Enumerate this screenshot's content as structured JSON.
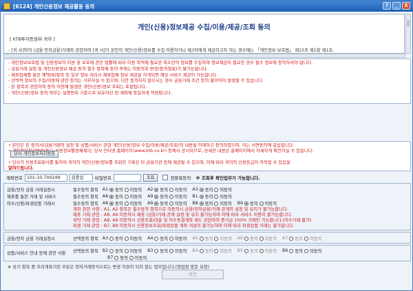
{
  "window": {
    "title": "[6124] 개인신용정보 제공활용 동의",
    "controls": [
      "?",
      "_",
      "X"
    ]
  },
  "document": {
    "title": "개인(신용)정보제공 수집/이용/제공/조회 동의",
    "recipient": "[ KTB투자증권㈜ 귀하 ]",
    "body": "- [귀 사]와의 (금융·전자금융)거래와 관련하여 [귀 사]가 본인의 개인(신용)정보를 수집 이용하거나 제3자에게 제공하고자 하는 경우에는 「개인정보 보호법」 제15조 제1항 제1호,"
  },
  "notice_top": [
    "- 개인정보보호법 및 신용정보의 이용 및 보호에 관한 법률에 따라 이용 목적에 필요한 최소한의 정보를 수집하며 정보제공이 필요한 경우 필수 정보에 동의하셔야 합니다.",
    "- 금융거래 설정 및 개인신용정보 제공 동의 필수 항목에 동의 후에는 미동의로 변경(동의철회)가 불가능합니다.",
    "- 제휴업체를 통한 혜택(B)항목 등 일부 정보 처리시 제휴업체 정보 제공을 하게되면 해당 서비스 제공이 가능합니다.",
    "- 선택적 정보의 수집/이용에 관한 동의는 거부하실 수 있으며, 다만 동의하지 않으시는 경우 금융거래 조건 등의 불이익이 발생할 수 있습니다.",
    "- 본 항목과 관련하여 동의 이전에 발생한 개인(신용)정보 조회는 포함됩니다.",
    "- 개인(신용)정보 동의 여부는 실명번호 기준으로 보유하신 전 계좌에 동일하게 적용됩니다."
  ],
  "notice_bottom": [
    "• 본인은 본 동의서(금융거래의 설정 및 상품/서비스 관련 개인(신용)정보 수집/이용/제공/조회)의 내용을 이해하고 동의하였으며, 이는 서면동의에 갈음합니다.",
    "• 개인정보처리방침(또는 신용정보활용체제)는 당사 인터넷 홈페이지(www.ktb.co.kr) 등에서 공시되므로, 상세한 내용은 홈페이지에서 자세하게 확인하실 수 있습니다.",
    "• 당사가 신용조회회사를 통하여 귀하의 개인(신용)정보를 조회한 기록은 타 금융기관 등에 제공될 수 있으며, 이에 따라 귀하의 신용등급이 하락할 수 있음을",
    "  알려드립니다."
  ],
  "print_button": "당사 개인정보처리방침",
  "account": {
    "label": "계좌번호",
    "value": "101-10-700249",
    "name": "김충섭",
    "password_label": "비밀번호",
    "query_button": "조회",
    "all_consent_label": "전항목동의",
    "hint": "※ 조회후 확인업무가 가능합니다."
  },
  "panel1": {
    "title_lines": [
      "금융/전자 금융 거래설정시",
      "제휴를 통한 거래 및 서비스",
      "미수/신용/파생상품 거래시"
    ],
    "mandatory_label": "필수동의 항목",
    "optional_label": "선택동의 항목",
    "row1": [
      {
        "code": "A1",
        "state": [
          "동의",
          "미동의"
        ]
      },
      {
        "code": "A2",
        "state": [
          "동의",
          "미동의"
        ]
      },
      {
        "code": "A3",
        "state": [
          "동의",
          "미동의"
        ]
      }
    ],
    "row2": [
      {
        "code": "A8",
        "state": [
          "동의",
          "미동의"
        ]
      },
      {
        "code": "A9",
        "state": [
          "동의",
          "미동의"
        ]
      },
      {
        "code": "B1",
        "state": [
          "동의",
          "미동의"
        ]
      }
    ],
    "row3": [
      {
        "code": "A8",
        "state": [
          "동의",
          "미동의"
        ]
      },
      {
        "code": "A9",
        "state": [
          "동의",
          "미동의"
        ]
      },
      {
        "code": "B8",
        "state": [
          "동의",
          "미동의"
        ]
      },
      {
        "code": "B9",
        "state": [
          "동의",
          "미동의"
        ]
      }
    ],
    "notes": [
      "계좌 관련 사항 : A1, A2 항목은 필수동의 항목으로 미동의시 금융(전자금융)거래 관계의 설정 및 유지가 불가능합니다.",
      "제휴 거래 관련 : A8, A9 미동의시 제휴 (금융)거래 관계 설정 및 유지 불가능하며 이에 따라 서비스 이용이 불가능합니다.",
      "위탁 거래 관련 : A8, A9 미동의시 신용조회/대출 및 미수동결계좌 제도 관련하여 증거금 100% 거래만 가능합니다.(미수거래 불가)",
      "파생 거래 관련 : B7, B9 미동의시 신용정보조회/파생상품 계좌 개설이 불가능하며 이에 따라 파생상품 거래는 불가합니다."
    ]
  },
  "panel2": {
    "title": "금융/전자 금융 거래설정시",
    "optional_label": "선택동의 항목",
    "items": [
      "A3",
      "A4",
      "A5",
      "A6",
      "A7"
    ],
    "agree": "동의",
    "disagree": "미동의"
  },
  "panel3": {
    "title": "상품/서비스 안내 등에 관한 사항",
    "optional_label": "선택동의 항목",
    "row1": [
      "B2",
      "B3",
      "B4",
      "B5",
      "B6"
    ],
    "row2": [
      "B7"
    ],
    "agree": "동의",
    "disagree": "미동의"
  },
  "footer_note": "※ 상기 항목 중 흐리게표기된 부분은 전자거래방식으로는 변경 지원이 되지 않는 업무입니다.(영업점 방문 요청)",
  "confirm_button": "확인"
}
